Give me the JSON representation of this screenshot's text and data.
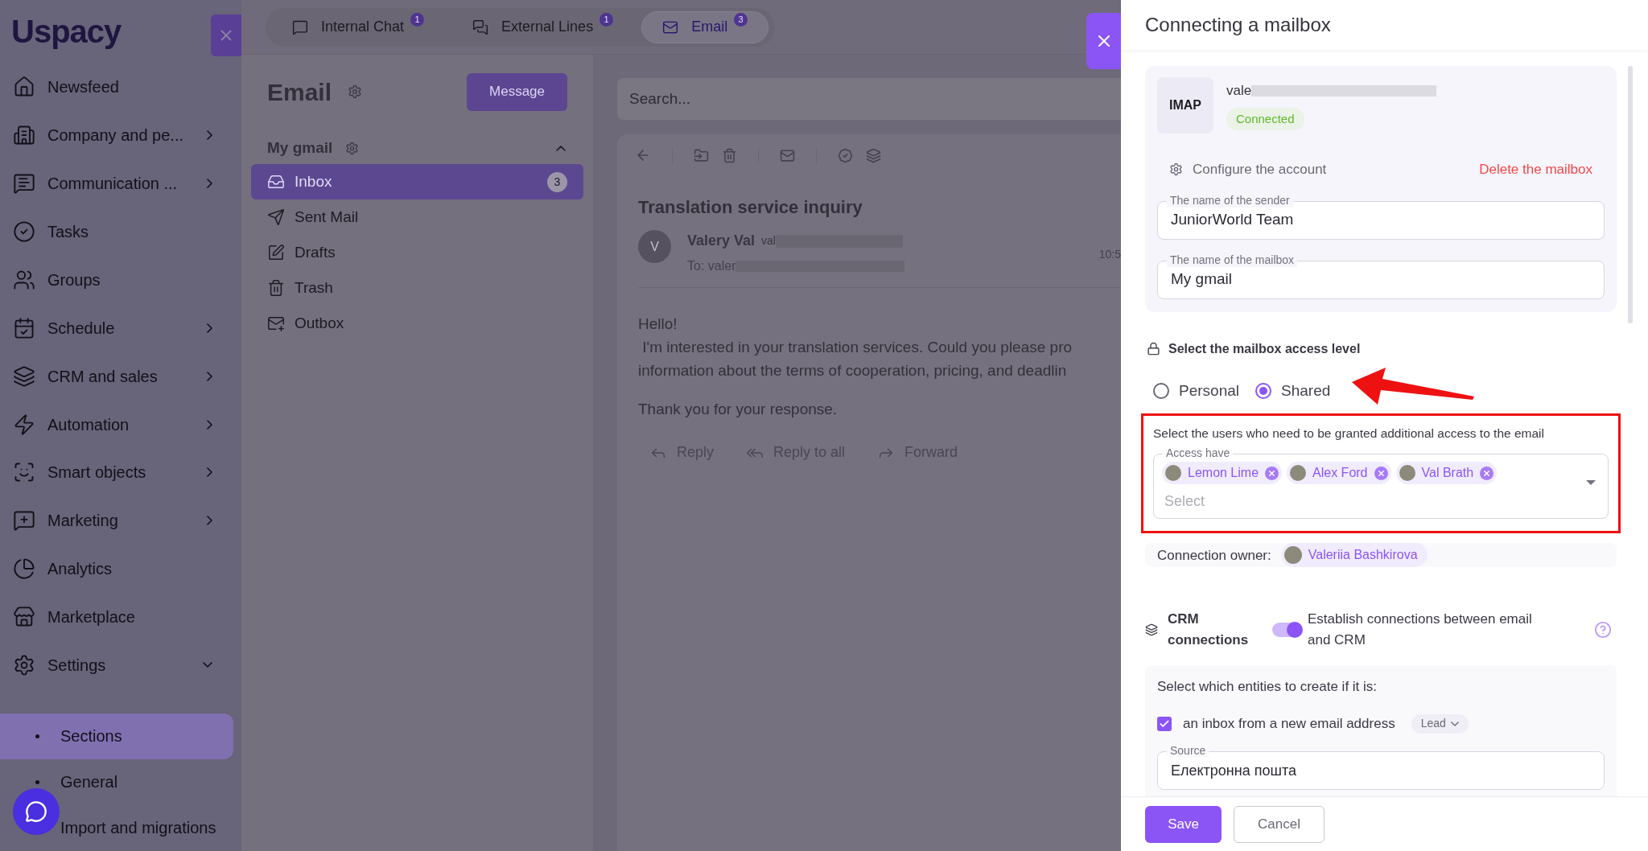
{
  "sidebar": {
    "logo": "Uspacy",
    "items": [
      {
        "label": "Newsfeed",
        "kind": "link"
      },
      {
        "label": "Company and pe...",
        "kind": "group",
        "expanded": false
      },
      {
        "label": "Communication ...",
        "kind": "group",
        "expanded": false
      },
      {
        "label": "Tasks",
        "kind": "link"
      },
      {
        "label": "Groups",
        "kind": "link"
      },
      {
        "label": "Schedule",
        "kind": "group",
        "expanded": false
      },
      {
        "label": "CRM and sales",
        "kind": "group",
        "expanded": false
      },
      {
        "label": "Automation",
        "kind": "group",
        "expanded": false
      },
      {
        "label": "Smart objects",
        "kind": "group",
        "expanded": false
      },
      {
        "label": "Marketing",
        "kind": "group",
        "expanded": false
      },
      {
        "label": "Analytics",
        "kind": "link"
      },
      {
        "label": "Marketplace",
        "kind": "link"
      },
      {
        "label": "Settings",
        "kind": "group",
        "expanded": true,
        "children": [
          {
            "label": "Sections",
            "selected": true
          },
          {
            "label": "General",
            "selected": false
          },
          {
            "label": "Import and migrations",
            "selected": false
          }
        ]
      }
    ]
  },
  "tabs": [
    {
      "label": "Internal Chat",
      "badge": "1",
      "selected": false
    },
    {
      "label": "External Lines",
      "badge": "1",
      "selected": false
    },
    {
      "label": "Email",
      "badge": "3",
      "selected": true
    }
  ],
  "mail": {
    "title": "Email",
    "compose_button": "Message",
    "mailbox": {
      "name": "My gmail",
      "expanded": true,
      "folders": [
        {
          "label": "Inbox",
          "count": "3",
          "selected": true
        },
        {
          "label": "Sent Mail",
          "selected": false
        },
        {
          "label": "Drafts",
          "selected": false
        },
        {
          "label": "Trash",
          "selected": false
        },
        {
          "label": "Outbox",
          "selected": false
        }
      ]
    }
  },
  "viewer": {
    "search_placeholder": "Search...",
    "subject": "Translation service inquiry",
    "avatar_letter": "V",
    "sender_name": "Valery Val",
    "sender_email": "val",
    "to": "To: valer",
    "time": "10:5",
    "body": [
      "Hello!",
      " I'm interested in your translation services. Could you please pro",
      "information about the terms of cooperation, pricing, and deadlin",
      "Thank you for your response."
    ],
    "actions": [
      "Reply",
      "Reply to all",
      "Forward"
    ]
  },
  "panel": {
    "title": "Connecting a mailbox",
    "account": {
      "type": "IMAP",
      "email": "vale",
      "status": "Connected",
      "configure": "Configure the account",
      "delete": "Delete the mailbox"
    },
    "fields": [
      {
        "label": "The name of the sender",
        "value": "JuniorWorld Team"
      },
      {
        "label": "The name of the mailbox",
        "value": "My gmail"
      }
    ],
    "access": {
      "title": "Select the mailbox access level",
      "options": [
        {
          "label": "Personal",
          "selected": false
        },
        {
          "label": "Shared",
          "selected": true
        }
      ],
      "hint": "Select the users who need to be granted additional access to the email",
      "field_label": "Access have",
      "users": [
        "Lemon Lime",
        "Alex Ford",
        "Val Brath"
      ],
      "placeholder": "Select"
    },
    "owner": {
      "label": "Connection owner:",
      "name": "Valeriia Bashkirova"
    },
    "crm": {
      "title": "CRM connections",
      "on": true,
      "description": "Establish connections between email and CRM"
    },
    "entities": {
      "title": "Select which entities to create if it is:",
      "rows": [
        {
          "label": "an inbox from a new email address",
          "checked": true,
          "entity": "Lead"
        }
      ],
      "source": {
        "label": "Source",
        "value": "Електронна пошта"
      }
    },
    "buttons": {
      "save": "Save",
      "cancel": "Cancel"
    }
  }
}
